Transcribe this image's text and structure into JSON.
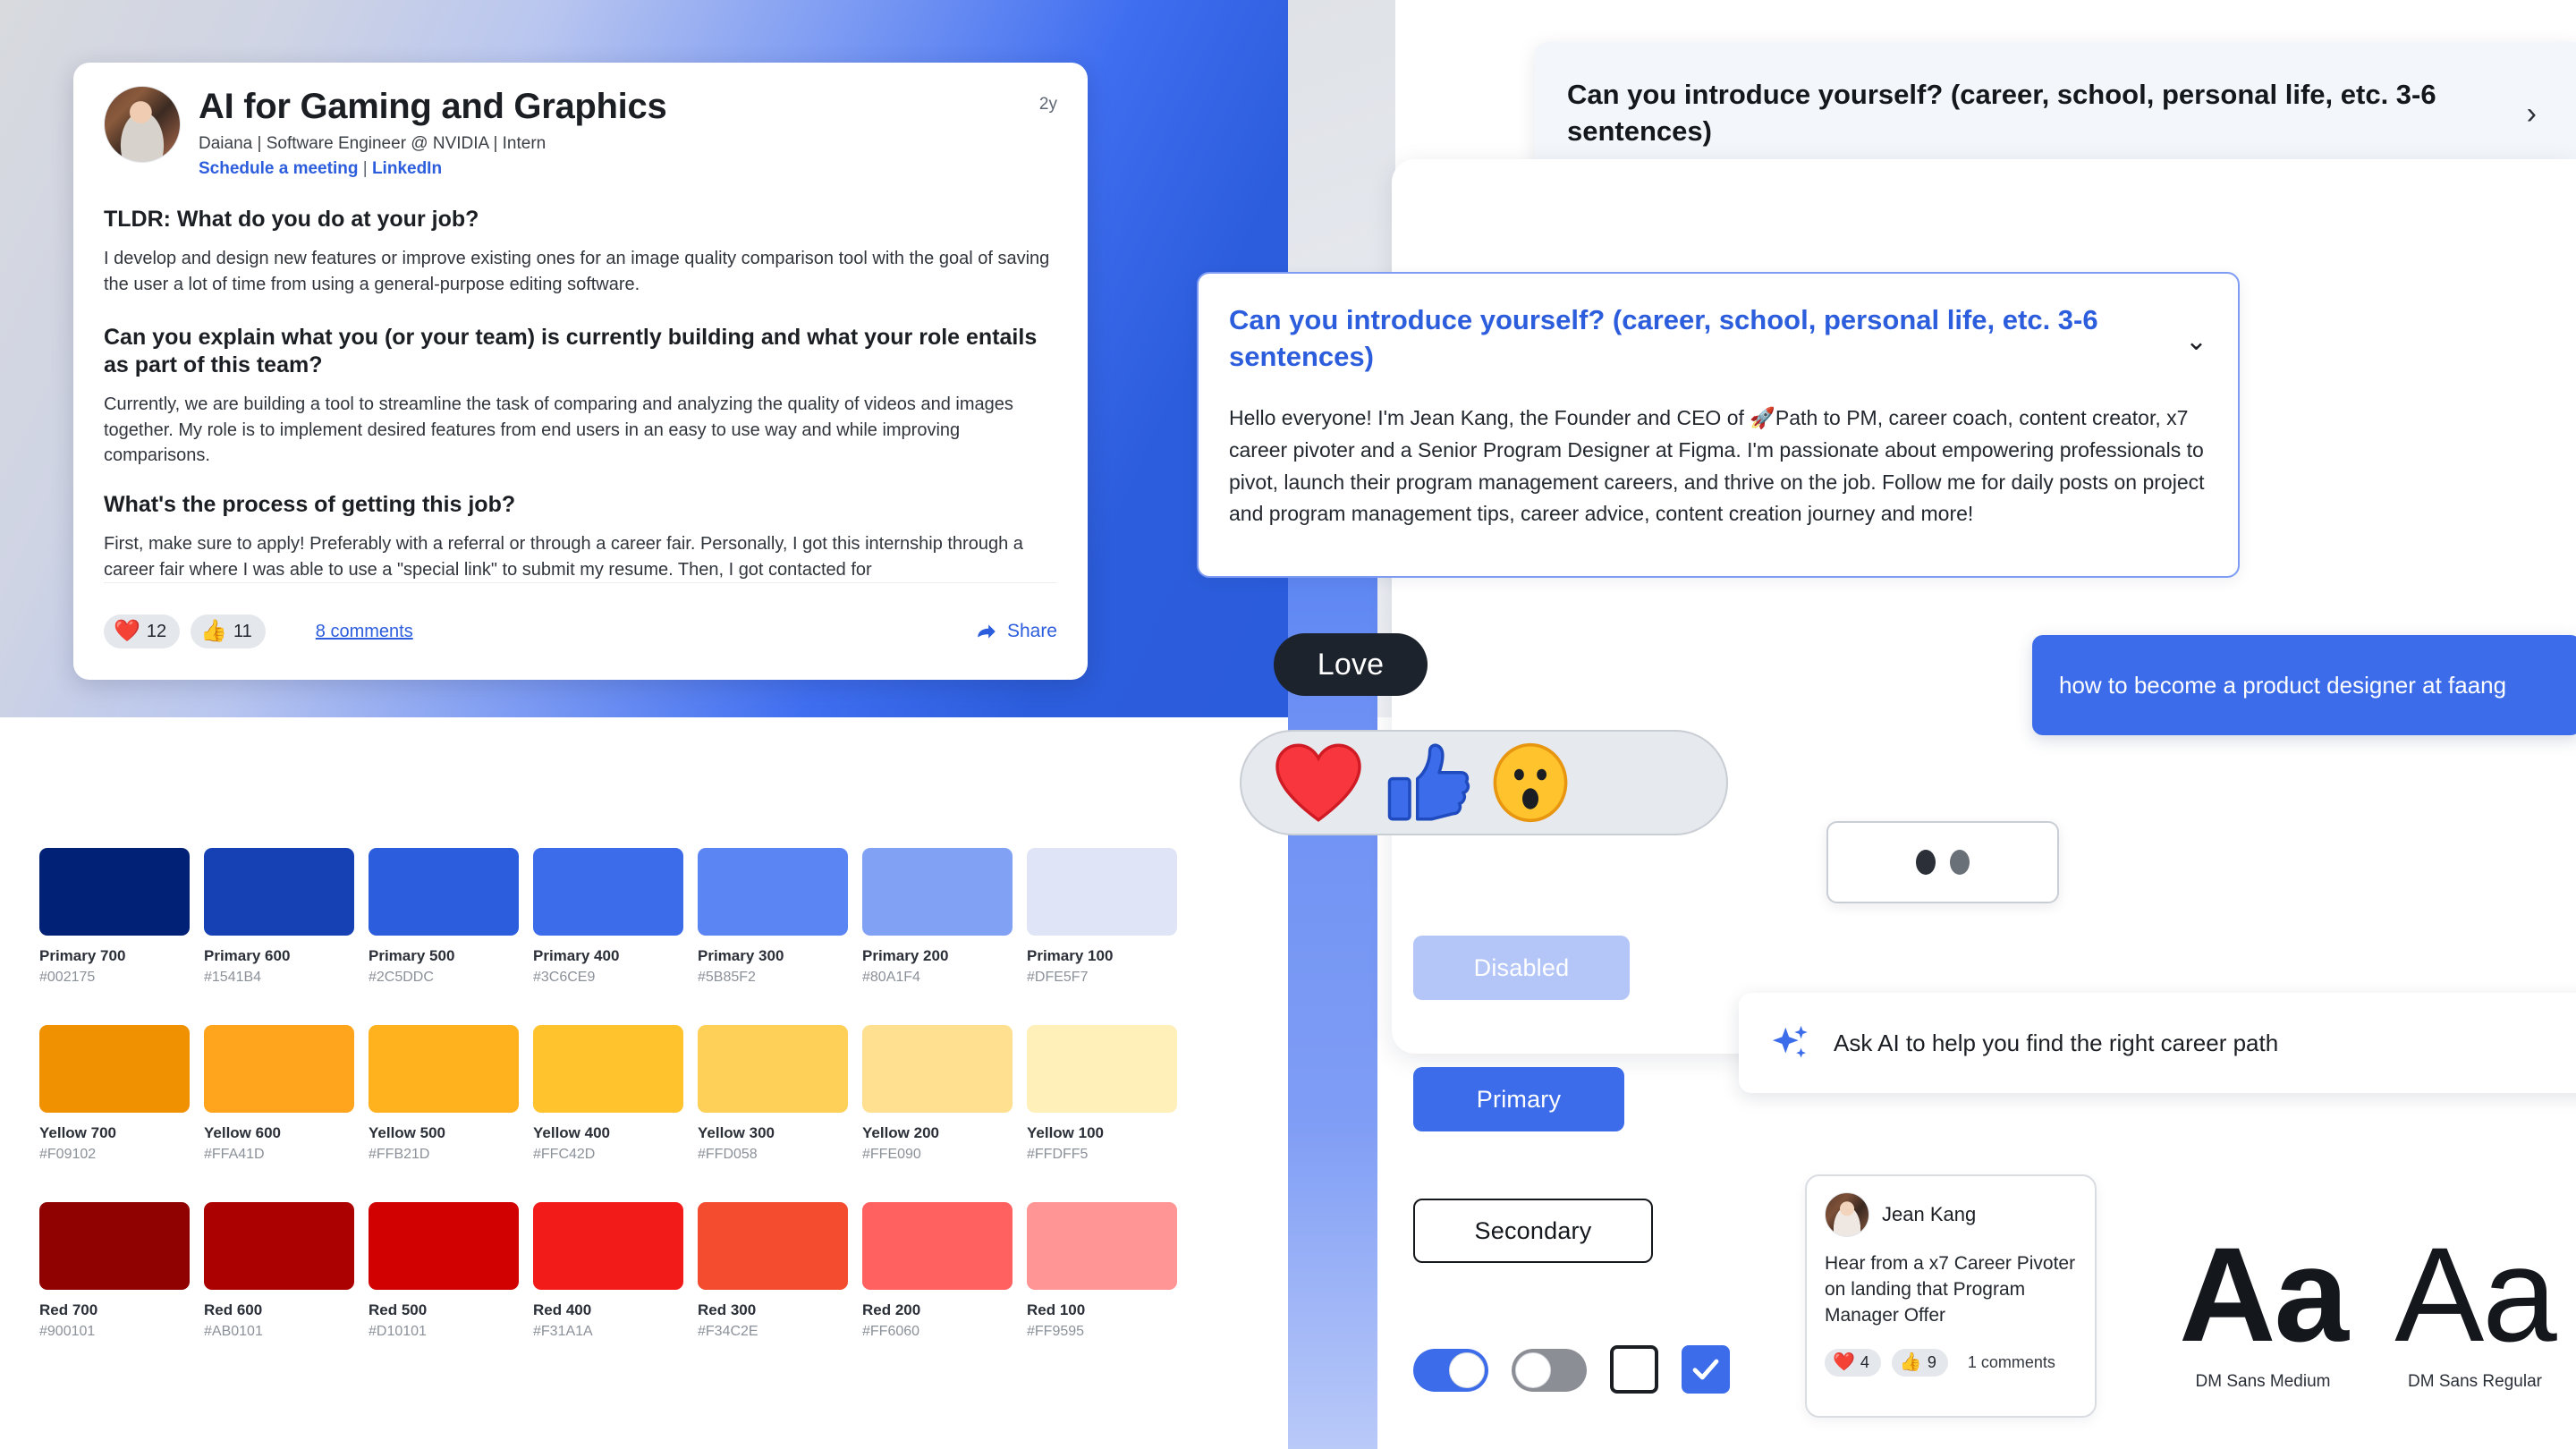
{
  "post": {
    "title": "AI for Gaming and Graphics",
    "subtitle": "Daiana | Software Engineer @ NVIDIA | Intern",
    "link_schedule": "Schedule a meeting",
    "link_separator": " | ",
    "link_linkedin": "LinkedIn",
    "age": "2y",
    "q1_heading": "TLDR: What do you do at your job?",
    "q1_answer": "I develop and design new features or improve existing ones for an image quality comparison tool with the goal of saving the user a lot of time from using a general-purpose editing software.",
    "q2_heading": "Can you explain what you (or your team) is currently building and what your role entails as part of this team?",
    "q2_answer": "Currently, we are building a tool to streamline the task of comparing and analyzing the quality of videos and images together. My role is to implement desired features from end users in an easy to use way and while improving comparisons.",
    "q3_heading": "What's the process of getting this job?",
    "q3_answer": "First, make sure to apply! Preferably with a referral or through a career fair. Personally, I got this internship through a career fair where I was able to use a \"special link\" to submit my resume. Then, I got contacted for",
    "reaction_love_count": "12",
    "reaction_like_count": "11",
    "comments_label": "8 comments",
    "share_label": "Share"
  },
  "question_collapsed": {
    "text": "Can you introduce yourself? (career, school, personal life, etc. 3-6 sentences)",
    "chevron": "chevron-right"
  },
  "question_expanded": {
    "title": "Can you introduce yourself? (career, school, personal life, etc. 3-6 sentences)",
    "answer": "Hello everyone! I'm Jean Kang, the Founder and CEO of 🚀Path to PM, career coach, content creator, x7 career pivoter and a Senior Program Designer at Figma. I'm passionate about empowering professionals to pivot, launch their program management careers, and thrive on the job. Follow me for daily posts on project and program management tips, career advice, content creation journey and more!",
    "chevron": "chevron-down"
  },
  "reactions": {
    "tooltip_label": "Love",
    "items": [
      "heart-reaction",
      "thumbs-up-reaction",
      "wow-reaction"
    ]
  },
  "buttons": {
    "disabled": "Disabled",
    "primary": "Primary",
    "secondary": "Secondary"
  },
  "search_chip": {
    "query": "how to become a product designer at faang"
  },
  "ask_ai": {
    "label": "Ask AI to help you find the right career path",
    "icon": "sparkle-icon"
  },
  "mini_post": {
    "author": "Jean Kang",
    "title": "Hear from a x7 Career Pivoter on landing that Program Manager Offer",
    "love_count": "4",
    "like_count": "9",
    "comments": "1 comments"
  },
  "typography": [
    {
      "sample": "Aa",
      "label": "DM Sans Medium"
    },
    {
      "sample": "Aa",
      "label": "DM Sans Regular"
    }
  ],
  "palette": [
    [
      {
        "name": "Primary 700",
        "hex": "#002175"
      },
      {
        "name": "Primary 600",
        "hex": "#1541B4"
      },
      {
        "name": "Primary 500",
        "hex": "#2C5DDC"
      },
      {
        "name": "Primary 400",
        "hex": "#3C6CE9"
      },
      {
        "name": "Primary 300",
        "hex": "#5B85F2"
      },
      {
        "name": "Primary 200",
        "hex": "#80A1F4"
      },
      {
        "name": "Primary 100",
        "hex": "#DFE5F7"
      }
    ],
    [
      {
        "name": "Yellow 700",
        "hex": "#F09102"
      },
      {
        "name": "Yellow 600",
        "hex": "#FFA41D"
      },
      {
        "name": "Yellow 500",
        "hex": "#FFB21D"
      },
      {
        "name": "Yellow 400",
        "hex": "#FFC42D"
      },
      {
        "name": "Yellow 300",
        "hex": "#FFD058"
      },
      {
        "name": "Yellow 200",
        "hex": "#FFE090"
      },
      {
        "name": "Yellow 100",
        "hex": "#FFDFF5"
      }
    ],
    [
      {
        "name": "Red 700",
        "hex": "#900101"
      },
      {
        "name": "Red 600",
        "hex": "#AB0101"
      },
      {
        "name": "Red 500",
        "hex": "#D10101"
      },
      {
        "name": "Red 400",
        "hex": "#F31A1A"
      },
      {
        "name": "Red 300",
        "hex": "#F34C2E"
      },
      {
        "name": "Red 200",
        "hex": "#FF6060"
      },
      {
        "name": "Red 100",
        "hex": "#FF9595"
      }
    ]
  ]
}
